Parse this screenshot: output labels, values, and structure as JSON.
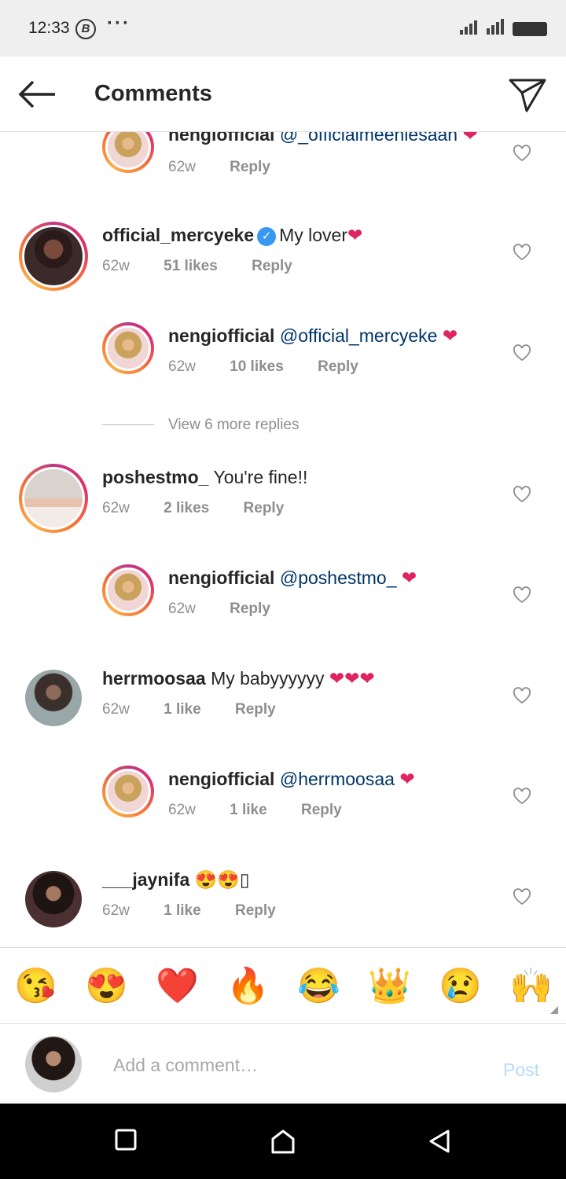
{
  "status_bar": {
    "time": "12:33",
    "b_icon": "B",
    "dots": "···"
  },
  "header": {
    "title": "Comments"
  },
  "comments": [
    {
      "user": "nengiofficial",
      "text": "@_officialmeeniesaan",
      "heart": "❤",
      "age": "62w",
      "likes": "",
      "reply": "Reply"
    },
    {
      "user": "official_mercyeke",
      "verified": true,
      "text": "My lover",
      "heart": "❤",
      "age": "62w",
      "likes": "51 likes",
      "reply": "Reply"
    },
    {
      "user": "nengiofficial",
      "text": "@official_mercyeke",
      "heart": "❤",
      "age": "62w",
      "likes": "10 likes",
      "reply": "Reply"
    },
    {
      "user": "poshestmo_",
      "text": "You're fine!!",
      "age": "62w",
      "likes": "2 likes",
      "reply": "Reply"
    },
    {
      "user": "nengiofficial",
      "text": "@poshestmo_",
      "heart": "❤",
      "age": "62w",
      "likes": "",
      "reply": "Reply"
    },
    {
      "user": "herrmoosaa",
      "text": "My babyyyyyy",
      "heart": "❤❤❤",
      "age": "62w",
      "likes": "1 like",
      "reply": "Reply"
    },
    {
      "user": "nengiofficial",
      "text": "@herrmoosaa",
      "heart": "❤",
      "age": "62w",
      "likes": "1 like",
      "reply": "Reply"
    },
    {
      "user": "___jaynifa",
      "text": "😍😍▯",
      "age": "62w",
      "likes": "1 like",
      "reply": "Reply"
    }
  ],
  "view_more": "View 6 more replies",
  "emoji_bar": [
    "😘",
    "😍",
    "❤️",
    "🔥",
    "😂",
    "👑",
    "😢",
    "🙌"
  ],
  "input": {
    "placeholder": "Add a comment…",
    "post_label": "Post"
  },
  "icons": {
    "back": "back-arrow-icon",
    "send": "direct-send-icon",
    "like": "heart-outline-icon",
    "verified": "verified-badge-icon"
  },
  "colors": {
    "mention": "#003569",
    "heart": "#e0245e",
    "meta": "#8e8e8e",
    "post_disabled": "#b3dbff",
    "verified": "#3897f0"
  }
}
